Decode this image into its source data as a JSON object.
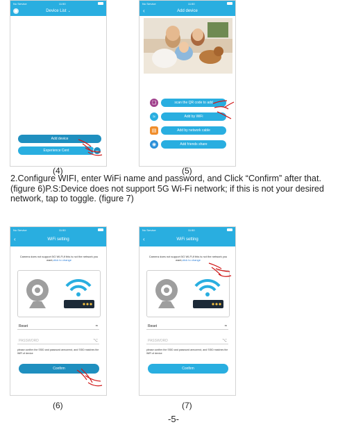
{
  "status": {
    "carrier": "No Service",
    "time": "11:50"
  },
  "p4": {
    "title": "Device List",
    "add_device": "Add device",
    "experience": "Experience Cent"
  },
  "p5": {
    "title": "Add device",
    "options": [
      {
        "label": "scan the QR code to add",
        "icon": "qr-code-icon",
        "color": "#a0408c"
      },
      {
        "label": "Add by WiFi",
        "icon": "wifi-icon",
        "color": "#29aee0"
      },
      {
        "label": "Add by network cable",
        "icon": "network-cable-icon",
        "color": "#f08d2a"
      },
      {
        "label": "Add friends share",
        "icon": "share-globe-icon",
        "color": "#2a8fd8"
      }
    ]
  },
  "wifi": {
    "title": "WiFi setting",
    "notice": "Camera does not support 5G Wi-Fi,if this is not the network you want,",
    "link": "click to change",
    "ssid": "Reset",
    "password_placeholder": "PASSWORD",
    "hint": "please confirm the SSID and password arecorrect, and SSID matches the WiFi of device",
    "confirm": "Confirm"
  },
  "captions": [
    "(4)",
    "(5)",
    "(6)",
    "(7)"
  ],
  "instructions": "2.Configure WIFI, enter WiFi name and password, and Click “Confirm” after that. (figure 6)P.S:Device does not support 5G Wi-Fi network; if this is not your desired network, tap to toggle. (figure 7)",
  "page_number": "-5-",
  "colors": {
    "accent": "#29aee0",
    "hand": "#d01616"
  }
}
